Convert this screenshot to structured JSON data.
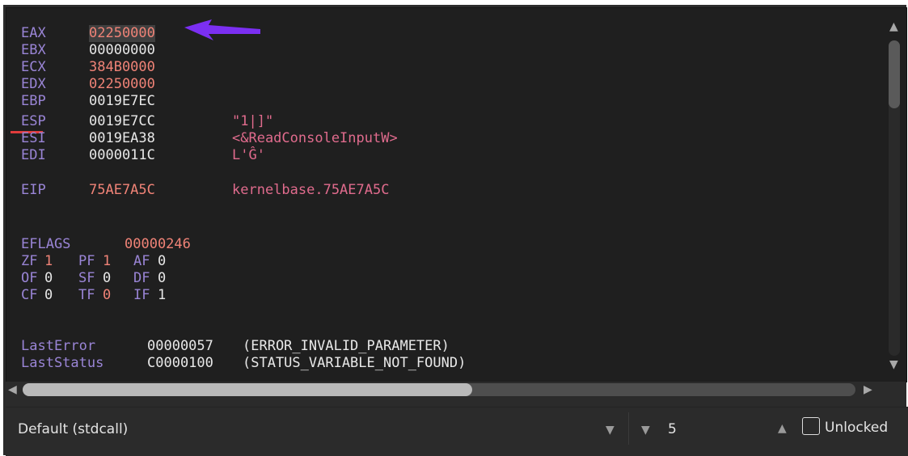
{
  "registers": {
    "eax": {
      "name": "EAX",
      "value": "02250000"
    },
    "ebx": {
      "name": "EBX",
      "value": "00000000"
    },
    "ecx": {
      "name": "ECX",
      "value": "384B0000"
    },
    "edx": {
      "name": "EDX",
      "value": "02250000"
    },
    "ebp": {
      "name": "EBP",
      "value": "0019E7EC"
    },
    "esp": {
      "name": "ESP",
      "value": "0019E7CC",
      "comment": "\"1|]\""
    },
    "esi": {
      "name": "ESI",
      "value": "0019EA38",
      "comment": "<&ReadConsoleInputW>"
    },
    "edi": {
      "name": "EDI",
      "value": "0000011C",
      "comment": "L'Ĝ'"
    },
    "eip": {
      "name": "EIP",
      "value": "75AE7A5C",
      "comment": "kernelbase.75AE7A5C"
    }
  },
  "eflags": {
    "name": "EFLAGS",
    "value": "00000246"
  },
  "flags": [
    {
      "name": "ZF",
      "value": "1"
    },
    {
      "name": "PF",
      "value": "1"
    },
    {
      "name": "AF",
      "value": "0"
    },
    {
      "name": "OF",
      "value": "0"
    },
    {
      "name": "SF",
      "value": "0"
    },
    {
      "name": "DF",
      "value": "0"
    },
    {
      "name": "CF",
      "value": "0"
    },
    {
      "name": "TF",
      "value": "0"
    },
    {
      "name": "IF",
      "value": "1"
    }
  ],
  "last_error": {
    "name": "LastError",
    "value": "00000057",
    "comment": "(ERROR_INVALID_PARAMETER)"
  },
  "last_status": {
    "name": "LastStatus",
    "value": "C0000100",
    "comment": "(STATUS_VARIABLE_NOT_FOUND)"
  },
  "toolbar": {
    "convention": "Default (stdcall)",
    "arg_count": "5",
    "unlocked_label": "Unlocked",
    "unlocked_checked": false
  },
  "icons": {
    "scroll_up": "triangle-up-icon",
    "scroll_down": "triangle-down-icon",
    "scroll_left": "triangle-left-icon",
    "scroll_right": "triangle-right-icon",
    "dropdown": "dropdown-arrow-icon",
    "annotation_arrow": "purple-arrow-icon"
  },
  "colors": {
    "background": "#1f1f1f",
    "register_name": "#9a85d6",
    "value_default": "#e8e8e8",
    "value_changed": "#f08377",
    "comment": "#e06b8d",
    "annotation_arrow": "#7b2ff2"
  }
}
